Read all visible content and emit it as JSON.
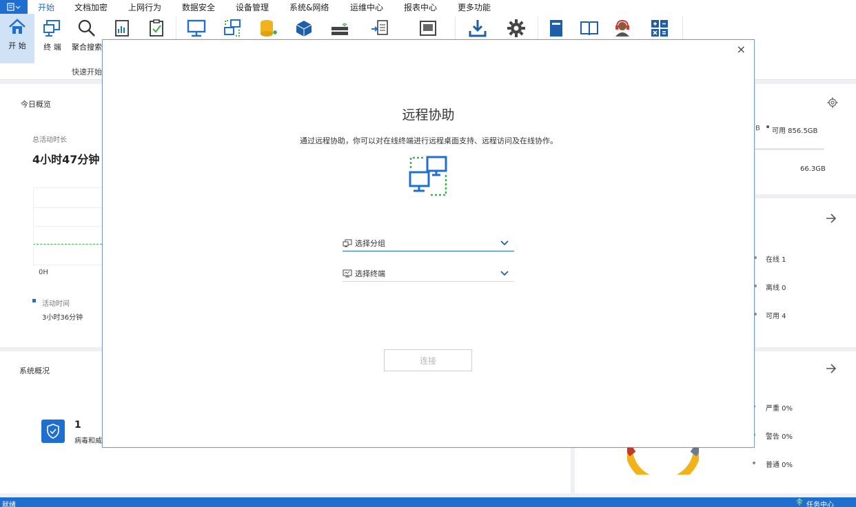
{
  "menubar": {
    "tabs": [
      "开始",
      "文档加密",
      "上网行为",
      "数据安全",
      "设备管理",
      "系统&网络",
      "运维中心",
      "报表中心",
      "更多功能"
    ],
    "active": "开始"
  },
  "ribbon": {
    "home_label": "开 始",
    "terminal_label": "终 端",
    "search_label": "聚合搜索",
    "group_label": "快速开始"
  },
  "overview": {
    "title": "今日概览",
    "total_time_label": "总活动时长",
    "total_time_value": "4小时47分钟",
    "axis_label": "0H",
    "legend_label": "活动时间",
    "legend_value": "3小时36分钟"
  },
  "system": {
    "title": "系统概况",
    "count": "1",
    "label": "病毒和威"
  },
  "disk": {
    "partial": "B",
    "available_label": "可用 856.5GB",
    "second_value": "66.3GB"
  },
  "terminals": {
    "online": "在线  1",
    "offline": "离线  0",
    "available": "可用  4"
  },
  "alerts": {
    "severe": "严重  0%",
    "warning": "警告  0%",
    "normal": "普通  0%"
  },
  "dialog": {
    "close": "×",
    "title": "远程协助",
    "description": "通过远程协助，你可以对在线终端进行远程桌面支持、远程访问及在线协作。",
    "select_group_placeholder": "选择分组",
    "select_terminal_placeholder": "选择终端",
    "connect_label": "连接"
  },
  "statusbar": {
    "left": "就绪",
    "right": "任务中心"
  },
  "colors": {
    "accent": "#1f6fd1",
    "green": "#3cb34a",
    "orange": "#f2b21c"
  }
}
